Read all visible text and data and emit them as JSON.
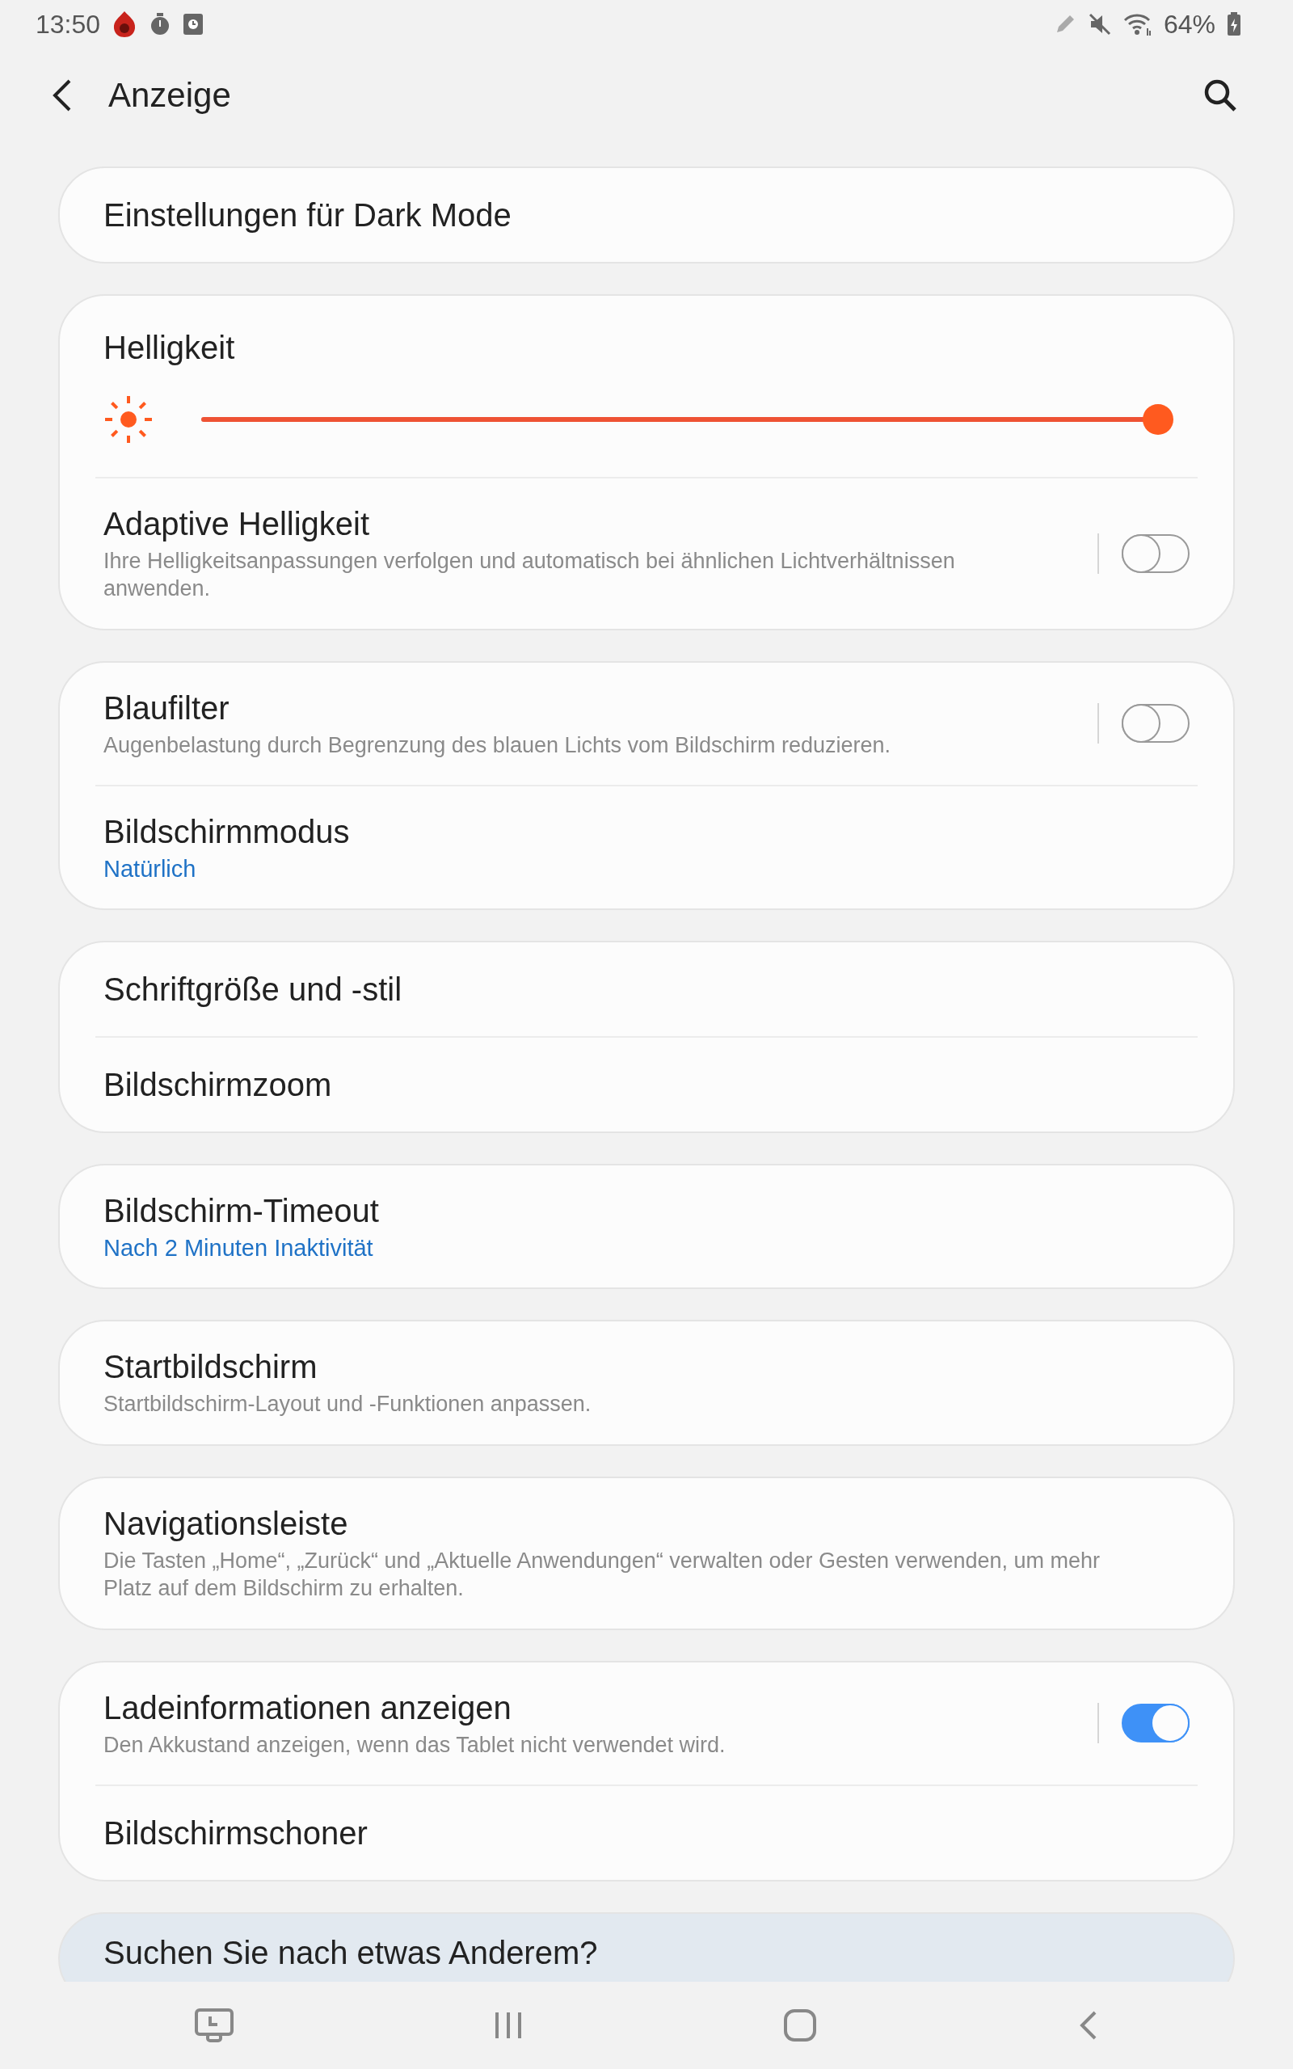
{
  "status_bar": {
    "time": "13:50",
    "battery": "64%"
  },
  "header": {
    "title": "Anzeige"
  },
  "groups": [
    {
      "items": [
        {
          "kind": "plain",
          "title": "Einstellungen für Dark Mode"
        }
      ]
    },
    {
      "items": [
        {
          "kind": "slider",
          "title": "Helligkeit",
          "level": 1
        },
        {
          "kind": "switch",
          "title": "Adaptive Helligkeit",
          "description": "Ihre Helligkeitsanpassungen verfolgen und automatisch bei ähnlichen Lichtverhältnissen anwenden.",
          "on": false
        }
      ]
    },
    {
      "items": [
        {
          "kind": "switch",
          "title": "Blaufilter",
          "description": "Augenbelastung durch Begrenzung des blauen Lichts vom Bildschirm reduzieren.",
          "on": false
        },
        {
          "kind": "plain",
          "title": "Bildschirmmodus",
          "summary": "Natürlich"
        }
      ]
    },
    {
      "items": [
        {
          "kind": "plain",
          "title": "Schriftgröße und -stil"
        },
        {
          "kind": "plain",
          "title": "Bildschirmzoom"
        }
      ]
    },
    {
      "items": [
        {
          "kind": "plain",
          "title": "Bildschirm-Timeout",
          "summary": "Nach 2 Minuten Inaktivität"
        }
      ]
    },
    {
      "items": [
        {
          "kind": "plain",
          "title": "Startbildschirm",
          "description": "Startbildschirm-Layout und -Funktionen anpassen."
        }
      ]
    },
    {
      "items": [
        {
          "kind": "plain",
          "title": "Navigationsleiste",
          "description": "Die Tasten „Home“, „Zurück“ und „Aktuelle Anwendungen“ verwalten oder Gesten verwenden, um mehr Platz auf dem Bildschirm zu erhalten."
        }
      ]
    },
    {
      "items": [
        {
          "kind": "switch",
          "title": "Ladeinformationen anzeigen",
          "description": "Den Akkustand anzeigen, wenn das Tablet nicht verwendet wird.",
          "on": true
        },
        {
          "kind": "plain",
          "title": "Bildschirmschoner"
        }
      ]
    }
  ],
  "suggestion": {
    "title": "Suchen Sie nach etwas Anderem?"
  }
}
